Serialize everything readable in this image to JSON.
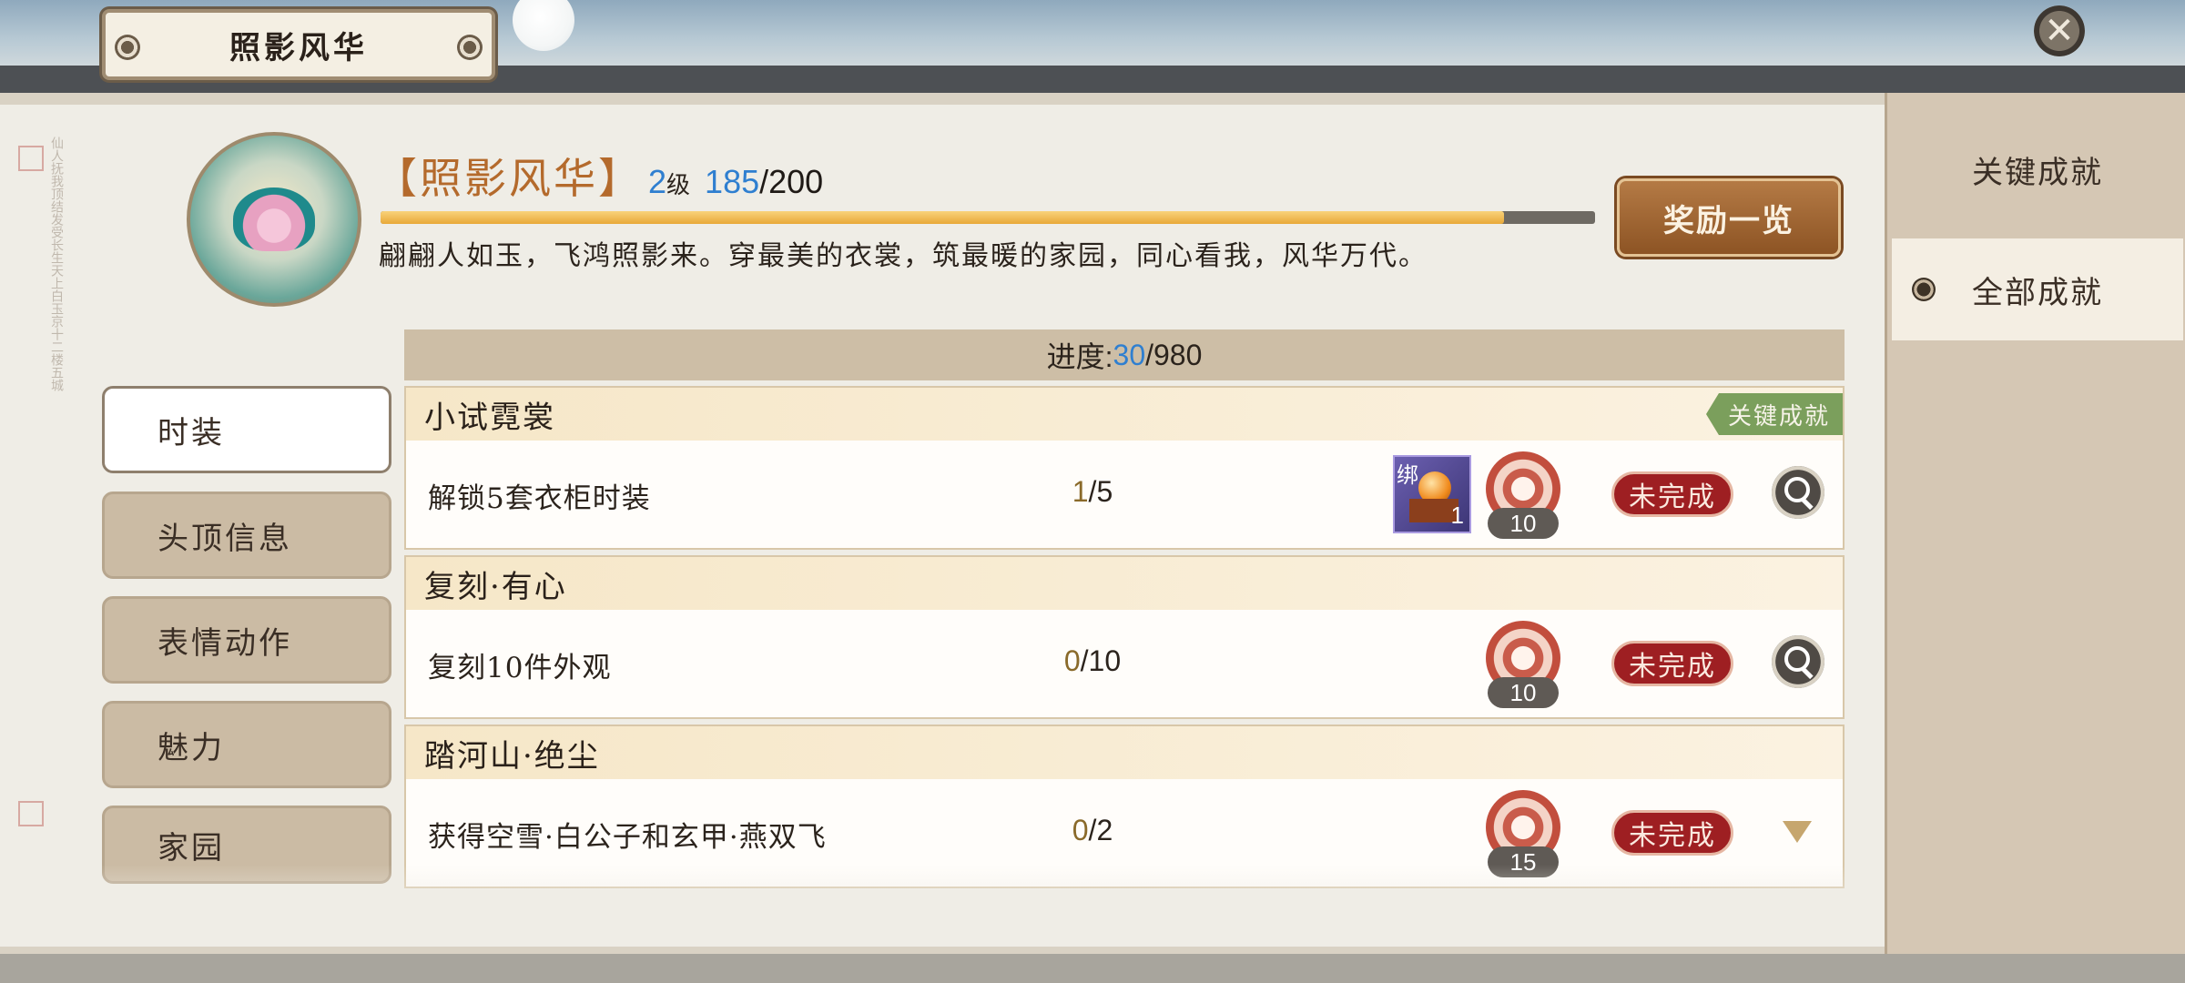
{
  "window": {
    "title": "照影风华"
  },
  "header": {
    "name": "【照影风华】",
    "level": "2",
    "level_unit": "级",
    "exp_current": "185",
    "exp_max": "/200",
    "exp_fraction": 0.925,
    "description": "翩翩人如玉，飞鸿照影来。穿最美的衣裳，筑最暖的家园，同心看我，风华万代。",
    "reward_button": "奖励一览"
  },
  "right_tabs": [
    {
      "label": "关键成就",
      "selected": false
    },
    {
      "label": "全部成就",
      "selected": true
    }
  ],
  "categories": [
    {
      "label": "时装",
      "active": true
    },
    {
      "label": "头顶信息",
      "active": false
    },
    {
      "label": "表情动作",
      "active": false
    },
    {
      "label": "魅力",
      "active": false
    },
    {
      "label": "家园",
      "active": false
    }
  ],
  "progress": {
    "label": "进度:",
    "current": "30",
    "total": "/980"
  },
  "achievements": [
    {
      "title": "小试霓裳",
      "tag": "关键成就",
      "task": "解锁5套衣柜时装",
      "done": "1",
      "total": "/5",
      "item": {
        "bind_label": "绑",
        "qty": "1"
      },
      "points": "10",
      "status": "未完成",
      "action": "search-icon"
    },
    {
      "title": "复刻·有心",
      "task": "复刻10件外观",
      "done": "0",
      "total": "/10",
      "points": "10",
      "status": "未完成",
      "action": "search-icon"
    },
    {
      "title": "踏河山·绝尘",
      "task": "获得空雪·白公子和玄甲·燕双飞",
      "done": "0",
      "total": "/2",
      "points": "15",
      "status": "未完成",
      "action": "expand-arrow-icon"
    }
  ],
  "colors": {
    "accent_blue": "#2f7fd0",
    "status_red": "#9e1f22",
    "tag_green": "#7b9f5c",
    "title_orange": "#b46a2c"
  }
}
